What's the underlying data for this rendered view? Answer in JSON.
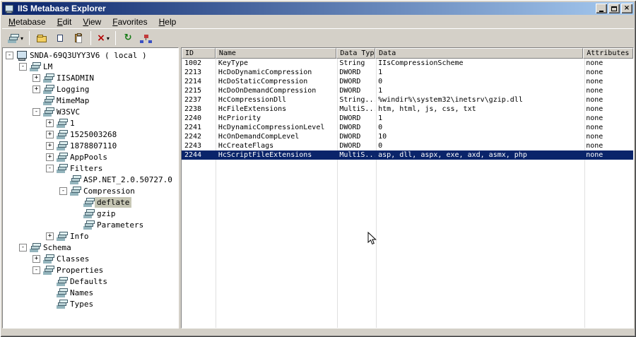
{
  "window": {
    "title": "IIS Metabase Explorer"
  },
  "menu": {
    "items": [
      "Metabase",
      "Edit",
      "View",
      "Favorites",
      "Help"
    ]
  },
  "toolbar": {
    "buttons": [
      "new-key",
      "open",
      "copy",
      "paste",
      "delete",
      "refresh",
      "connections"
    ]
  },
  "colors": {
    "titlebar_start": "#0a246a",
    "titlebar_end": "#a6caf0",
    "chrome": "#d4d0c8",
    "selected_row_bg": "#0a246a",
    "inactive_selection_bg": "#c6c6b4"
  },
  "tree": {
    "items": [
      {
        "depth": 0,
        "toggle": "-",
        "icon": "computer",
        "label": "SNDA-69Q3UYY3V6 ( local )",
        "selected": false
      },
      {
        "depth": 1,
        "toggle": "-",
        "icon": "key",
        "label": "LM",
        "selected": false
      },
      {
        "depth": 2,
        "toggle": "+",
        "icon": "key",
        "label": "IISADMIN",
        "selected": false
      },
      {
        "depth": 2,
        "toggle": "+",
        "icon": "key",
        "label": "Logging",
        "selected": false
      },
      {
        "depth": 2,
        "toggle": "",
        "icon": "key",
        "label": "MimeMap",
        "selected": false
      },
      {
        "depth": 2,
        "toggle": "-",
        "icon": "key",
        "label": "W3SVC",
        "selected": false
      },
      {
        "depth": 3,
        "toggle": "+",
        "icon": "key",
        "label": "1",
        "selected": false
      },
      {
        "depth": 3,
        "toggle": "+",
        "icon": "key",
        "label": "1525003268",
        "selected": false
      },
      {
        "depth": 3,
        "toggle": "+",
        "icon": "key",
        "label": "1878807110",
        "selected": false
      },
      {
        "depth": 3,
        "toggle": "+",
        "icon": "key",
        "label": "AppPools",
        "selected": false
      },
      {
        "depth": 3,
        "toggle": "-",
        "icon": "key",
        "label": "Filters",
        "selected": false
      },
      {
        "depth": 4,
        "toggle": "",
        "icon": "key",
        "label": "ASP.NET_2.0.50727.0",
        "selected": false
      },
      {
        "depth": 4,
        "toggle": "-",
        "icon": "key",
        "label": "Compression",
        "selected": false
      },
      {
        "depth": 5,
        "toggle": "",
        "icon": "key",
        "label": "deflate",
        "selected": true
      },
      {
        "depth": 5,
        "toggle": "",
        "icon": "key",
        "label": "gzip",
        "selected": false
      },
      {
        "depth": 5,
        "toggle": "",
        "icon": "key",
        "label": "Parameters",
        "selected": false
      },
      {
        "depth": 3,
        "toggle": "+",
        "icon": "key",
        "label": "Info",
        "selected": false
      },
      {
        "depth": 1,
        "toggle": "-",
        "icon": "key",
        "label": "Schema",
        "selected": false
      },
      {
        "depth": 2,
        "toggle": "+",
        "icon": "key",
        "label": "Classes",
        "selected": false
      },
      {
        "depth": 2,
        "toggle": "-",
        "icon": "key",
        "label": "Properties",
        "selected": false
      },
      {
        "depth": 3,
        "toggle": "",
        "icon": "key",
        "label": "Defaults",
        "selected": false
      },
      {
        "depth": 3,
        "toggle": "",
        "icon": "key",
        "label": "Names",
        "selected": false
      },
      {
        "depth": 3,
        "toggle": "",
        "icon": "key",
        "label": "Types",
        "selected": false
      }
    ]
  },
  "table": {
    "columns": [
      "ID",
      "Name",
      "Data Type",
      "Data",
      "Attributes"
    ],
    "selected_row_index": 10,
    "rows": [
      [
        "1002",
        "KeyType",
        "String",
        "IIsCompressionScheme",
        "none"
      ],
      [
        "2213",
        "HcDoDynamicCompression",
        "DWORD",
        "1",
        "none"
      ],
      [
        "2214",
        "HcDoStaticCompression",
        "DWORD",
        "0",
        "none"
      ],
      [
        "2215",
        "HcDoOnDemandCompression",
        "DWORD",
        "1",
        "none"
      ],
      [
        "2237",
        "HcCompressionDll",
        "String...",
        "%windir%\\system32\\inetsrv\\gzip.dll",
        "none"
      ],
      [
        "2238",
        "HcFileExtensions",
        "MultiS...",
        "htm, html, js, css, txt",
        "none"
      ],
      [
        "2240",
        "HcPriority",
        "DWORD",
        "1",
        "none"
      ],
      [
        "2241",
        "HcDynamicCompressionLevel",
        "DWORD",
        "0",
        "none"
      ],
      [
        "2242",
        "HcOnDemandCompLevel",
        "DWORD",
        "10",
        "none"
      ],
      [
        "2243",
        "HcCreateFlags",
        "DWORD",
        "0",
        "none"
      ],
      [
        "2244",
        "HcScriptFileExtensions",
        "MultiS...",
        "asp, dll, aspx, exe, axd, asmx, php",
        "none"
      ]
    ]
  }
}
